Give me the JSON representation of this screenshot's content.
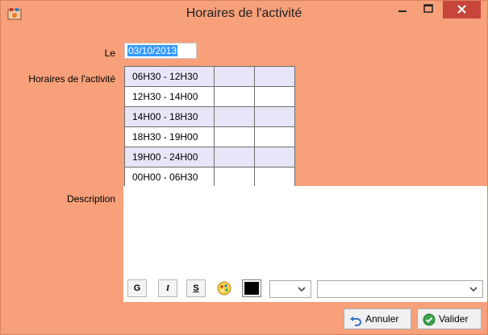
{
  "window": {
    "title": "Horaires de l'activité"
  },
  "form": {
    "date_label": "Le",
    "date_value": "03/10/2013",
    "schedule_label": "Horaires de l'activité",
    "description_label": "Description"
  },
  "schedule": {
    "rows": [
      "06H30 - 12H30",
      "12H30 - 14H00",
      "14H00 - 18H30",
      "18H30 - 19H00",
      "19H00 - 24H00",
      "00H00 - 06H30"
    ]
  },
  "toolbar": {
    "bold_label": "G",
    "italic_label": "I",
    "underline_label": "S",
    "selected_color": "#000000"
  },
  "buttons": {
    "cancel_label": "Annuler",
    "validate_label": "Valider"
  },
  "colors": {
    "window_background": "#f7a07a",
    "close_button": "#c7463b",
    "shaded_row": "#e6e6f8"
  }
}
